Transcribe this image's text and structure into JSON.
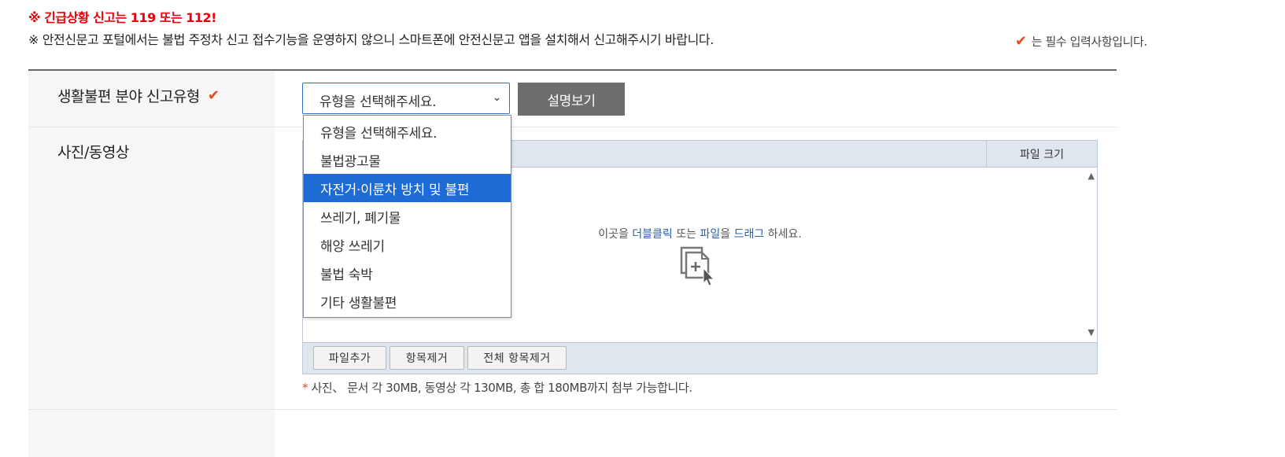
{
  "notices": {
    "emergency": "※ 긴급상황 신고는 119 또는 112!",
    "info": "※ 안전신문고 포털에서는 불법 주정차 신고 접수기능을 운영하지 않으니 스마트폰에 안전신문고 앱을 설치해서 신고해주시기 바랍니다.",
    "required": "는 필수 입력사항입니다."
  },
  "form": {
    "category_label": "생활불편 분야 신고유형",
    "select_value": "유형을 선택해주세요.",
    "explain_button": "설명보기",
    "media_label": "사진/동영상",
    "file_size_header": "파일 크기",
    "drop_text_1": "이곳을 ",
    "drop_text_2": "더블클릭",
    "drop_text_3": " 또는 ",
    "drop_text_4": "파일",
    "drop_text_5": "을 ",
    "drop_text_6": "드래그",
    "drop_text_7": " 하세요.",
    "add_file": "파일추가",
    "remove_item": "항목제거",
    "remove_all": "전체 항목제거",
    "attach_star": "*",
    "attach_note": " 사진、 문서 각 30MB, 동영상 각 130MB, 총 합 180MB까지 첨부 가능합니다."
  },
  "dropdown": {
    "options": [
      "유형을 선택해주세요.",
      "불법광고물",
      "자전거·이륜차 방치 및 불편",
      "쓰레기, 폐기물",
      "해양 쓰레기",
      "불법 숙박",
      "기타 생활불편"
    ],
    "selected_index": 2
  },
  "colors": {
    "accent_check": "#e8491d",
    "emergency_red": "#e8000b",
    "selection_blue": "#1e6bd6"
  },
  "icons": {
    "required": "check-icon",
    "drop": "add-file-cursor-icon"
  }
}
